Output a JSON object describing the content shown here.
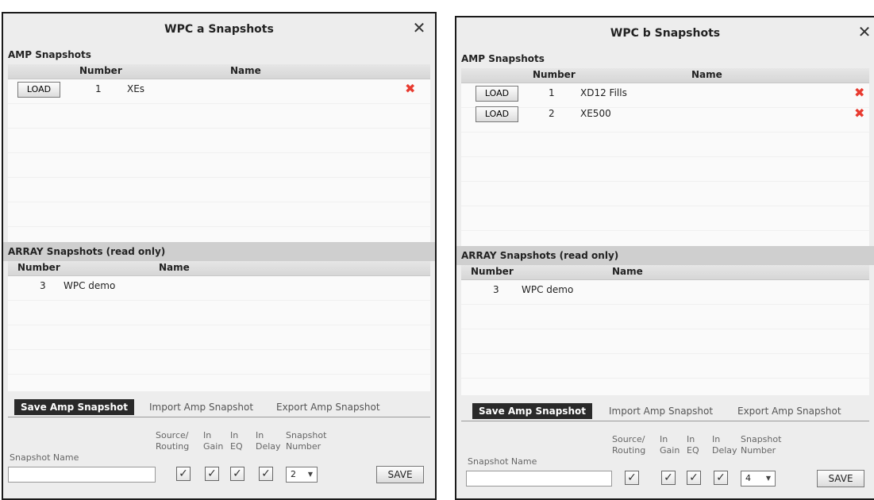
{
  "dialogs": [
    {
      "title": "WPC a Snapshots",
      "close": "✕",
      "amp_section_title": "AMP Snapshots",
      "amp_columns": {
        "number": "Number",
        "name": "Name"
      },
      "amp_rows": [
        {
          "load": "LOAD",
          "number": "1",
          "name": "XEs",
          "delete": "✖"
        }
      ],
      "array_section_title": "ARRAY Snapshots (read only)",
      "array_columns": {
        "number": "Number",
        "name": "Name"
      },
      "array_rows": [
        {
          "number": "3",
          "name": "WPC demo"
        }
      ],
      "tabs": [
        "Save Amp Snapshot",
        "Import Amp Snapshot",
        "Export Amp Snapshot"
      ],
      "save": {
        "snapshot_name_label": "Snapshot Name",
        "snapshot_name_value": "",
        "source_routing_label_1": "Source/",
        "source_routing_label_2": "Routing",
        "in_gain_label_1": "In",
        "in_gain_label_2": "Gain",
        "in_eq_label_1": "In",
        "in_eq_label_2": "EQ",
        "in_delay_label_1": "In",
        "in_delay_label_2": "Delay",
        "snapshot_number_label_1": "Snapshot",
        "snapshot_number_label_2": "Number",
        "check_mark": "✓",
        "snapshot_number_value": "2",
        "dropdown_arrow": "▼",
        "save_button": "SAVE"
      }
    },
    {
      "title": "WPC b Snapshots",
      "close": "✕",
      "amp_section_title": "AMP Snapshots",
      "amp_columns": {
        "number": "Number",
        "name": "Name"
      },
      "amp_rows": [
        {
          "load": "LOAD",
          "number": "1",
          "name": "XD12 Fills",
          "delete": "✖"
        },
        {
          "load": "LOAD",
          "number": "2",
          "name": "XE500",
          "delete": "✖"
        }
      ],
      "array_section_title": "ARRAY Snapshots (read only)",
      "array_columns": {
        "number": "Number",
        "name": "Name"
      },
      "array_rows": [
        {
          "number": "3",
          "name": "WPC demo"
        }
      ],
      "tabs": [
        "Save Amp Snapshot",
        "Import Amp Snapshot",
        "Export Amp Snapshot"
      ],
      "save": {
        "snapshot_name_label": "Snapshot Name",
        "snapshot_name_value": "",
        "source_routing_label_1": "Source/",
        "source_routing_label_2": "Routing",
        "in_gain_label_1": "In",
        "in_gain_label_2": "Gain",
        "in_eq_label_1": "In",
        "in_eq_label_2": "EQ",
        "in_delay_label_1": "In",
        "in_delay_label_2": "Delay",
        "snapshot_number_label_1": "Snapshot",
        "snapshot_number_label_2": "Number",
        "check_mark": "✓",
        "snapshot_number_value": "4",
        "dropdown_arrow": "▼",
        "save_button": "SAVE"
      }
    }
  ]
}
